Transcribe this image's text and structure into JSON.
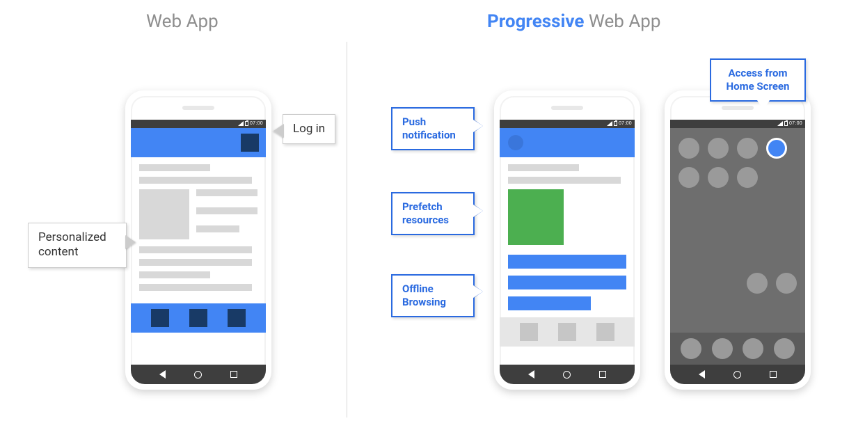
{
  "titles": {
    "left": "Web App",
    "right_accent": "Progressive",
    "right_rest": " Web App"
  },
  "status_time": "07:00",
  "callouts": {
    "login": "Log in",
    "personalized": "Personalized content",
    "push": "Push notification",
    "prefetch": "Prefetch resources",
    "offline": "Offline Browsing",
    "home": "Access from Home Screen"
  }
}
